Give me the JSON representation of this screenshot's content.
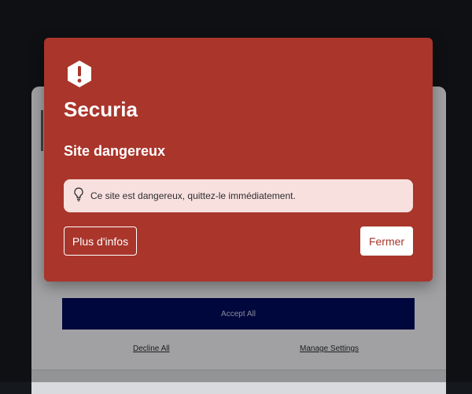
{
  "dialog": {
    "brand": "Securia",
    "headline": "Site dangereux",
    "message": "Ce site est dangereux, quittez-le immédiatement.",
    "more_label": "Plus d'infos",
    "close_label": "Fermer",
    "icons": {
      "alert": "alert-hexagon-icon",
      "tip": "lightbulb-icon"
    }
  },
  "consent": {
    "accept_label": "Accept All",
    "decline_label": "Decline All",
    "settings_label": "Manage Settings"
  },
  "colors": {
    "dialog_bg": "#a9352b",
    "message_bg": "#f8e0df",
    "accept_bg": "#000b5a",
    "page_bg": "#15191d"
  }
}
